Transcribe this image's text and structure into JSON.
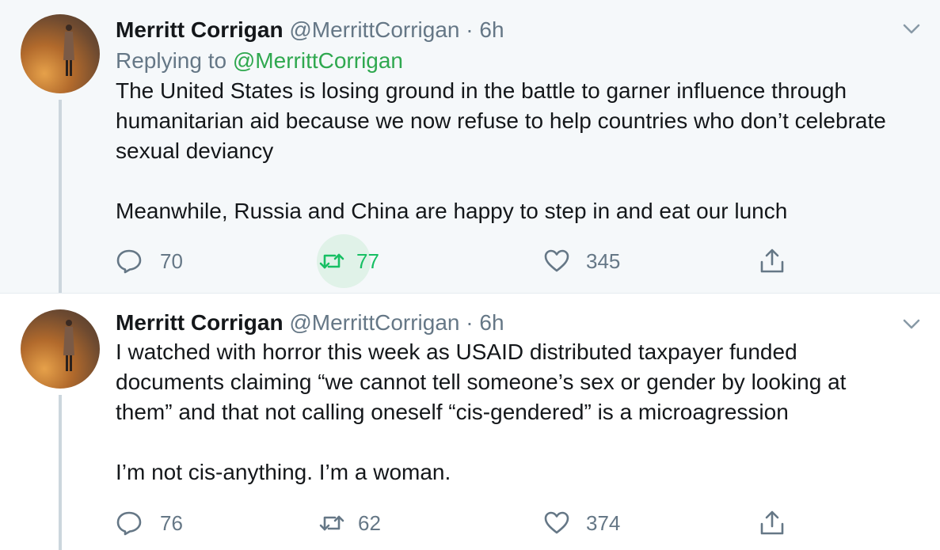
{
  "tweets": [
    {
      "name": "Merritt Corrigan",
      "handle": "@MerrittCorrigan",
      "separator": "·",
      "time": "6h",
      "replying_prefix": "Replying to",
      "replying_to": "@MerrittCorrigan",
      "paragraphs": [
        "The United States is losing ground in the battle to garner influence through humanitarian aid because we now refuse to help countries who don’t celebrate sexual deviancy",
        "Meanwhile, Russia and China are happy to step in and eat our lunch"
      ],
      "replies": "70",
      "retweets": "77",
      "likes": "345"
    },
    {
      "name": "Merritt Corrigan",
      "handle": "@MerrittCorrigan",
      "separator": "·",
      "time": "6h",
      "paragraphs": [
        "I watched with horror this week as USAID distributed taxpayer funded documents claiming “we cannot tell someone’s sex or gender by looking at them” and that not calling oneself “cis-gendered” is a microagression",
        "I’m not cis-anything. I’m a woman."
      ],
      "replies": "76",
      "retweets": "62",
      "likes": "374"
    }
  ],
  "colors": {
    "name": "#14171a",
    "secondary": "#657786",
    "mention": "#2fa84f",
    "retweet_active": "#17bf63",
    "selected_bg": "#f5f8fa",
    "thread_line": "#ccd6dd"
  },
  "icons": {
    "avatar": "avatar",
    "caret": "chevron-down-icon",
    "reply": "reply-icon",
    "retweet": "retweet-icon",
    "like": "heart-icon",
    "share": "share-icon"
  }
}
